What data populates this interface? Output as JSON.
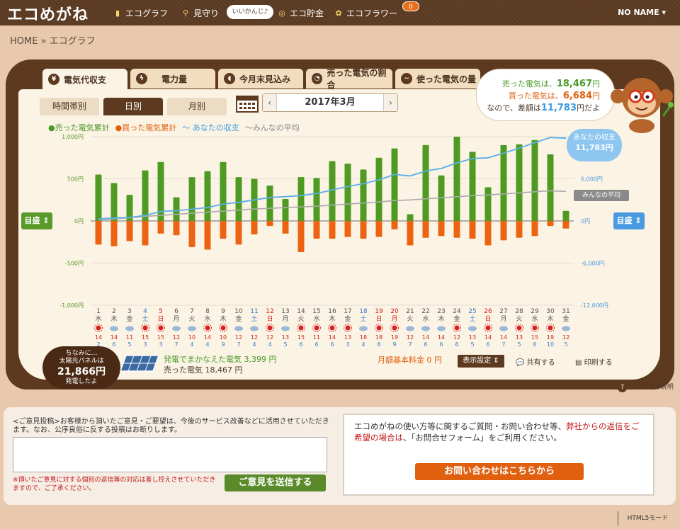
{
  "header": {
    "logo": "エコめがね",
    "nav": [
      {
        "label": "エコグラフ",
        "icon": "bar-chart-icon"
      },
      {
        "label": "見守り",
        "icon": "magnifier-icon"
      },
      {
        "label": "エコ貯金",
        "icon": "coin-icon"
      },
      {
        "label": "エコフラワー",
        "icon": "flower-icon"
      }
    ],
    "bubble": "いいかんじ♪",
    "badge": "0",
    "user": "NO NAME ▾"
  },
  "breadcrumb": "HOME » エコグラフ",
  "tabs": [
    "電気代収支",
    "電力量",
    "今月末見込み",
    "売った電気の割合",
    "使った電気の量"
  ],
  "subtabs": [
    "時間帯別",
    "日別",
    "月別"
  ],
  "month": {
    "label": "2017年3月",
    "prev": "‹",
    "next": "›"
  },
  "summary": {
    "sold_label": "売った電気は、",
    "sold_value": "18,467",
    "sold_unit": "円",
    "bought_label": "買った電気は、",
    "bought_value": "6,684",
    "bought_unit": "円",
    "diff_label": "なので、差額は",
    "diff_value": "11,783",
    "diff_unit": "円だよ"
  },
  "legend": {
    "sold": "●売った電気累計",
    "bought": "●買った電気累計",
    "mine": "〜 あなたの収支",
    "avg": "〜みんなの平均"
  },
  "meter_left": "目盛 ⇕",
  "meter_right": "目盛 ⇕",
  "callout_mine": {
    "title": "あなたの収支",
    "value": "11,783円"
  },
  "callout_avg": "みんなの平均",
  "chart_data": {
    "type": "bar",
    "left_axis": {
      "ticks": [
        "1,000円",
        "500円",
        "0円",
        "-500円",
        "-1,000円"
      ],
      "range": [
        -1000,
        1000
      ]
    },
    "right_axis": {
      "ticks": [
        "12,000円",
        "6,000円",
        "0円",
        "-6,000円",
        "-12,000円"
      ],
      "range": [
        -12000,
        12000
      ]
    },
    "days": [
      "1",
      "2",
      "3",
      "4",
      "5",
      "6",
      "7",
      "8",
      "9",
      "10",
      "11",
      "12",
      "13",
      "14",
      "15",
      "16",
      "17",
      "18",
      "19",
      "20",
      "21",
      "22",
      "23",
      "24",
      "25",
      "26",
      "27",
      "28",
      "29",
      "30",
      "31"
    ],
    "weekdays": [
      "水",
      "木",
      "金",
      "土",
      "日",
      "月",
      "火",
      "水",
      "木",
      "金",
      "土",
      "日",
      "月",
      "火",
      "水",
      "木",
      "金",
      "土",
      "日",
      "月",
      "火",
      "水",
      "木",
      "金",
      "土",
      "日",
      "月",
      "火",
      "水",
      "木",
      "金"
    ],
    "day_colors": [
      "n",
      "n",
      "n",
      "sat",
      "sun",
      "n",
      "n",
      "n",
      "n",
      "n",
      "sat",
      "sun",
      "n",
      "n",
      "n",
      "n",
      "n",
      "sat",
      "sun",
      "sun",
      "n",
      "n",
      "n",
      "n",
      "sat",
      "sun",
      "n",
      "n",
      "n",
      "n",
      "n"
    ],
    "weather": [
      "sun",
      "cloud",
      "cloud",
      "sun",
      "sun",
      "cloud",
      "cloud",
      "sun",
      "sun",
      "cloud",
      "cloud",
      "sun",
      "cloud",
      "sun",
      "sun",
      "sun",
      "sun",
      "cloud",
      "sun",
      "sun",
      "cloud",
      "cloud",
      "cloud",
      "sun",
      "cloud",
      "sun",
      "cloud",
      "sun",
      "sun",
      "sun",
      "cloud"
    ],
    "temp_high": [
      "14",
      "14",
      "11",
      "15",
      "15",
      "12",
      "10",
      "14",
      "10",
      "12",
      "12",
      "12",
      "13",
      "15",
      "11",
      "14",
      "13",
      "18",
      "18",
      "19",
      "12",
      "14",
      "14",
      "12",
      "13",
      "14",
      "14",
      "13",
      "15",
      "19",
      "12"
    ],
    "temp_low": [
      "2",
      "6",
      "5",
      "3",
      "3",
      "7",
      "4",
      "4",
      "9",
      "7",
      "4",
      "4",
      "5",
      "6",
      "6",
      "6",
      "3",
      "4",
      "6",
      "9",
      "7",
      "6",
      "6",
      "6",
      "5",
      "6",
      "7",
      "5",
      "6",
      "10",
      "5"
    ],
    "sold": [
      550,
      450,
      310,
      600,
      700,
      280,
      520,
      590,
      700,
      520,
      500,
      420,
      260,
      520,
      510,
      710,
      680,
      610,
      750,
      860,
      80,
      900,
      540,
      1000,
      820,
      400,
      900,
      910,
      960,
      790,
      120
    ],
    "bought": [
      -280,
      -300,
      -240,
      -290,
      -150,
      -170,
      -310,
      -340,
      -210,
      -280,
      -160,
      -60,
      -150,
      -370,
      -210,
      -210,
      -190,
      -210,
      -190,
      -100,
      -290,
      -200,
      -180,
      -200,
      -210,
      -290,
      -230,
      -200,
      -180,
      -60,
      -90
    ],
    "mine_cumulative": [
      270,
      420,
      490,
      800,
      1350,
      1460,
      1670,
      1920,
      2410,
      2650,
      2990,
      3350,
      3460,
      3610,
      3910,
      4410,
      4900,
      5300,
      5860,
      6620,
      6410,
      7110,
      7470,
      8270,
      8880,
      8990,
      9660,
      10370,
      11150,
      11880,
      11783
    ],
    "avg_cumulative": [
      150,
      300,
      450,
      650,
      800,
      950,
      1100,
      1250,
      1400,
      1550,
      1700,
      1800,
      1900,
      2000,
      2100,
      2250,
      2400,
      2550,
      2700,
      2900,
      3000,
      3150,
      3300,
      3450,
      3600,
      3700,
      3850,
      4000,
      4150,
      4300,
      4200
    ]
  },
  "solar": {
    "line1": "ちなみに…",
    "line2": "太陽光パネルは",
    "value": "21,866円",
    "line3": "発電したよ"
  },
  "generation": {
    "covered": "発電でまかなえた電気 3,399 円",
    "sold": "売った電気 18,467 円"
  },
  "basic_fee": "月額基本料金 0 円",
  "display_settings": "表示設定 ⇕",
  "share": "共有する",
  "print": "印刷する",
  "help": "よくわかる説明",
  "feedback": {
    "text": "<ご意見投稿>お客様から頂いたご意見・ご要望は、今後のサービス改善などに活用させていただきます。なお、公序良俗に反する投稿はお断りします。",
    "note": "※頂いたご意見に対する個別の返信等の対応は差し控えさせていただきますので、ご了承ください。",
    "send": "ご意見を送信する"
  },
  "contact": {
    "text1": "エコめがねの使い方等に関するご質問・お問い合わせ等、",
    "text1_red": "弊社からの返信をご希望の場合は",
    "text2": "、「お問合せフォーム」をご利用ください。",
    "button": "お問い合わせはこちらから"
  },
  "html5": "HTML5モード"
}
